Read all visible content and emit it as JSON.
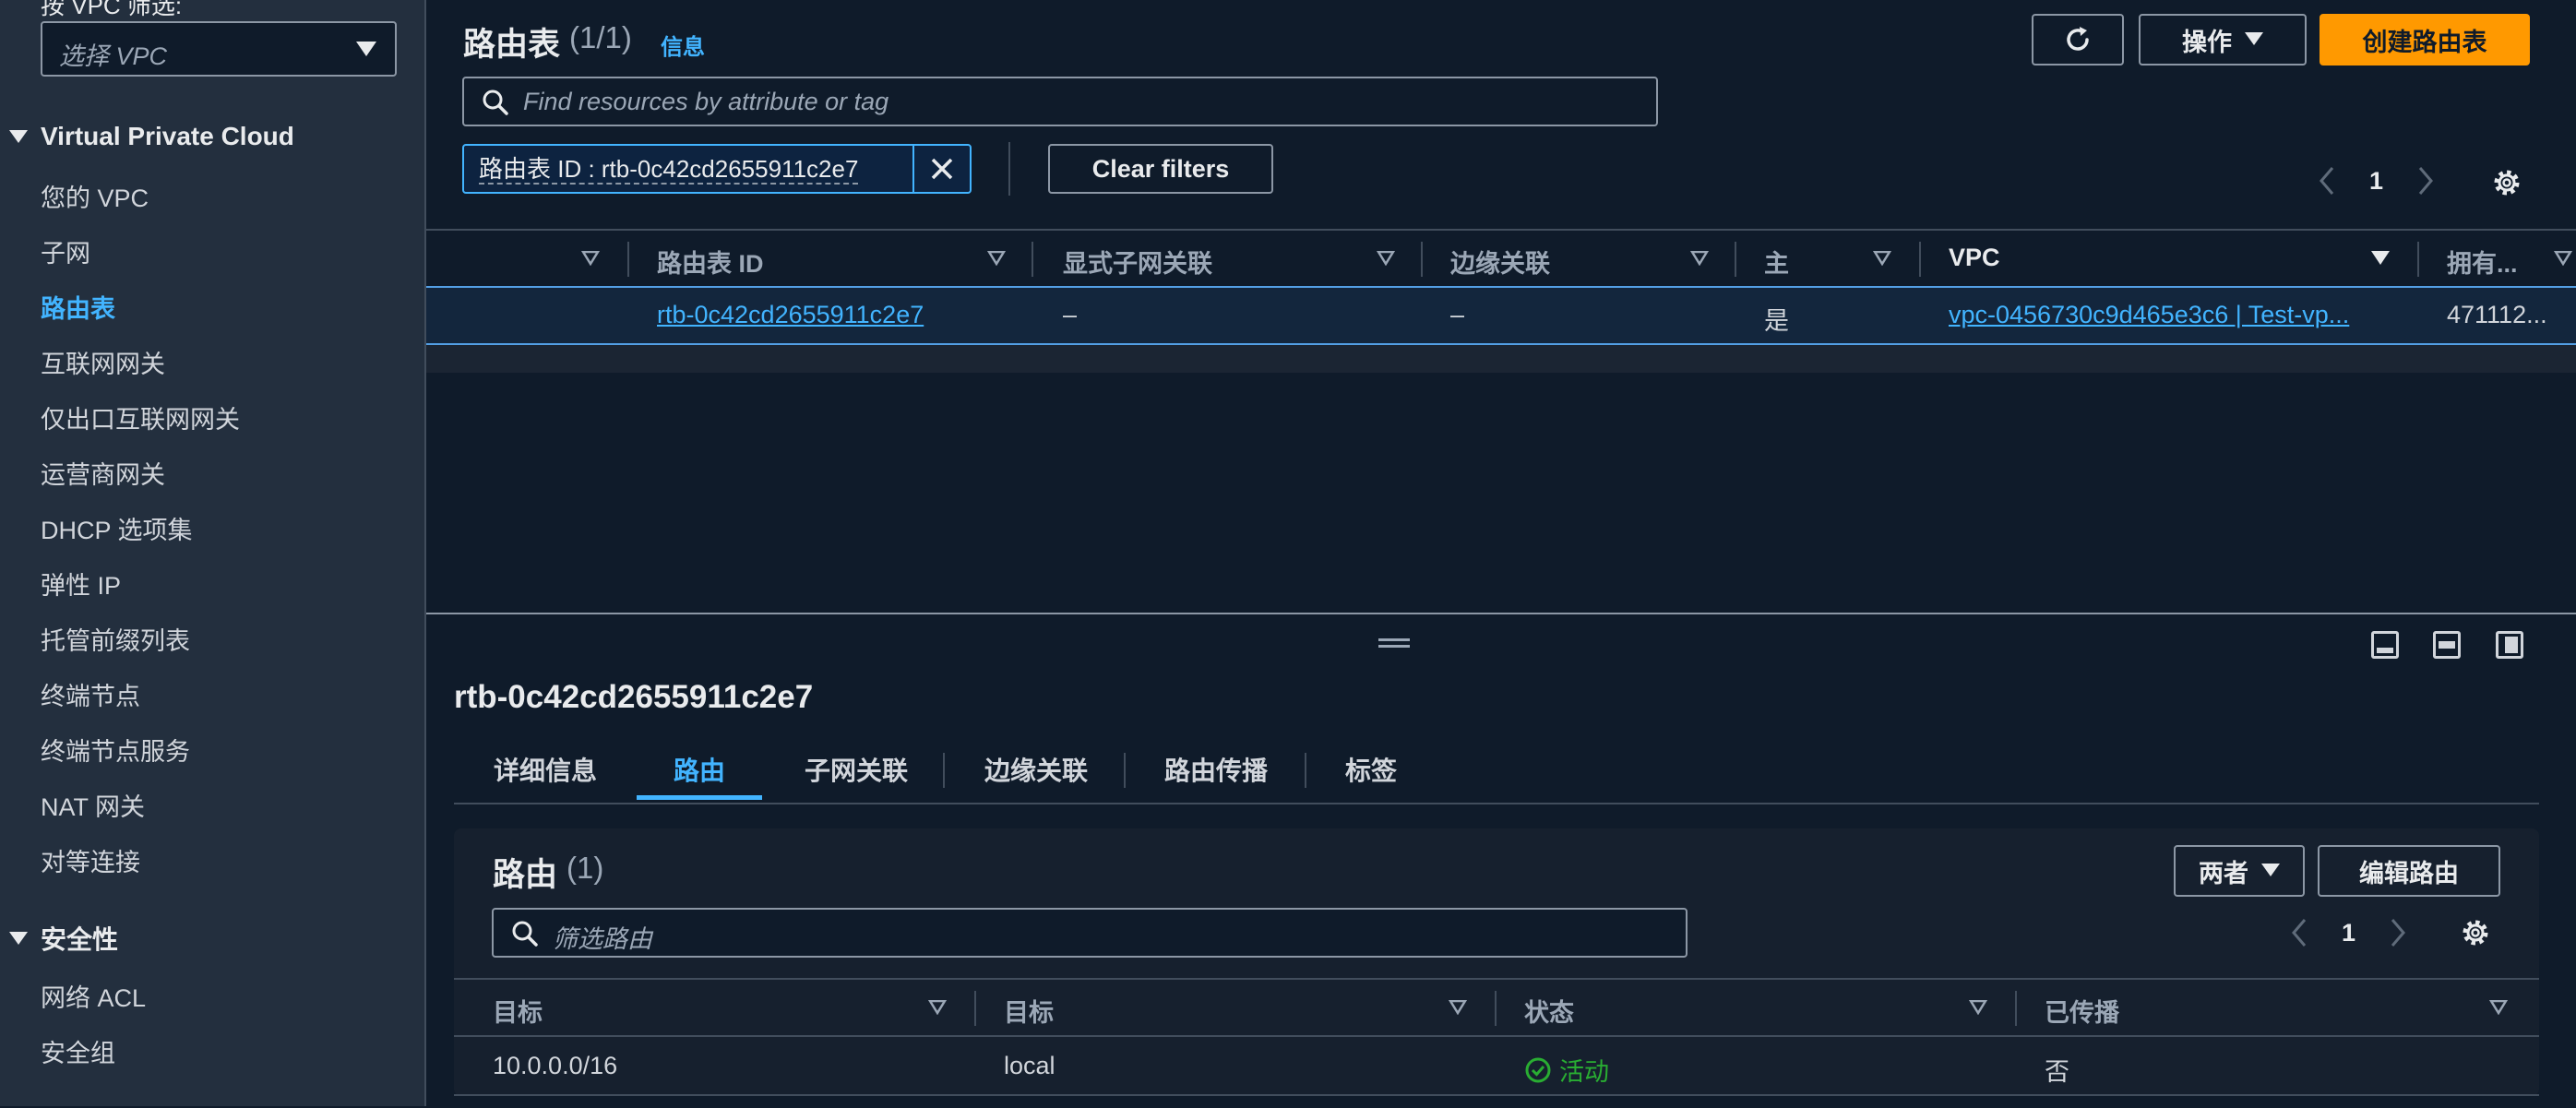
{
  "sidebar": {
    "vpc_select_label": "按 VPC 筛选:",
    "vpc_select_placeholder": "选择 VPC",
    "section_vpc": "Virtual Private Cloud",
    "items": [
      {
        "label": "您的 VPC"
      },
      {
        "label": "子网"
      },
      {
        "label": "路由表",
        "active": true
      },
      {
        "label": "互联网网关"
      },
      {
        "label": "仅出口互联网网关"
      },
      {
        "label": "运营商网关"
      },
      {
        "label": "DHCP 选项集"
      },
      {
        "label": "弹性 IP"
      },
      {
        "label": "托管前缀列表"
      },
      {
        "label": "终端节点"
      },
      {
        "label": "终端节点服务"
      },
      {
        "label": "NAT 网关"
      },
      {
        "label": "对等连接"
      }
    ],
    "section_security": "安全性",
    "security_items": [
      {
        "label": "网络 ACL"
      },
      {
        "label": "安全组"
      }
    ]
  },
  "header": {
    "title": "路由表",
    "count": "(1/1)",
    "info_link": "信息",
    "refresh_icon": "refresh-icon",
    "actions_label": "操作",
    "create_label": "创建路由表",
    "search_placeholder": "Find resources by attribute or tag",
    "filter_token": "路由表 ID : rtb-0c42cd2655911c2e7",
    "clear_filters": "Clear filters",
    "page": "1"
  },
  "route_tables": {
    "columns": [
      "路由表 ID",
      "显式子网关联",
      "边缘关联",
      "主",
      "VPC",
      "拥有..."
    ],
    "rows": [
      {
        "id": "rtb-0c42cd2655911c2e7",
        "explicit_subnet": "–",
        "edge": "–",
        "main": "是",
        "vpc": "vpc-0456730c9d465e3c6 | Test-vp...",
        "owner": "471112..."
      }
    ]
  },
  "detail": {
    "title": "rtb-0c42cd2655911c2e7",
    "tabs": [
      {
        "label": "详细信息"
      },
      {
        "label": "路由",
        "active": true
      },
      {
        "label": "子网关联"
      },
      {
        "label": "边缘关联"
      },
      {
        "label": "路由传播"
      },
      {
        "label": "标签"
      }
    ],
    "routes_title": "路由",
    "routes_count": "(1)",
    "filter_select": "两者",
    "edit_routes": "编辑路由",
    "routes_search_placeholder": "筛选路由",
    "page": "1",
    "columns": [
      "目标",
      "目标",
      "状态",
      "已传播"
    ],
    "rows": [
      {
        "destination": "10.0.0.0/16",
        "target": "local",
        "status": "活动",
        "propagated": "否"
      }
    ]
  },
  "colors": {
    "accent": "#42b4ff",
    "primary_button": "#ff9900",
    "status_active": "#29ad32",
    "background": "#0f1b2a",
    "sidebar": "#232f3e"
  }
}
